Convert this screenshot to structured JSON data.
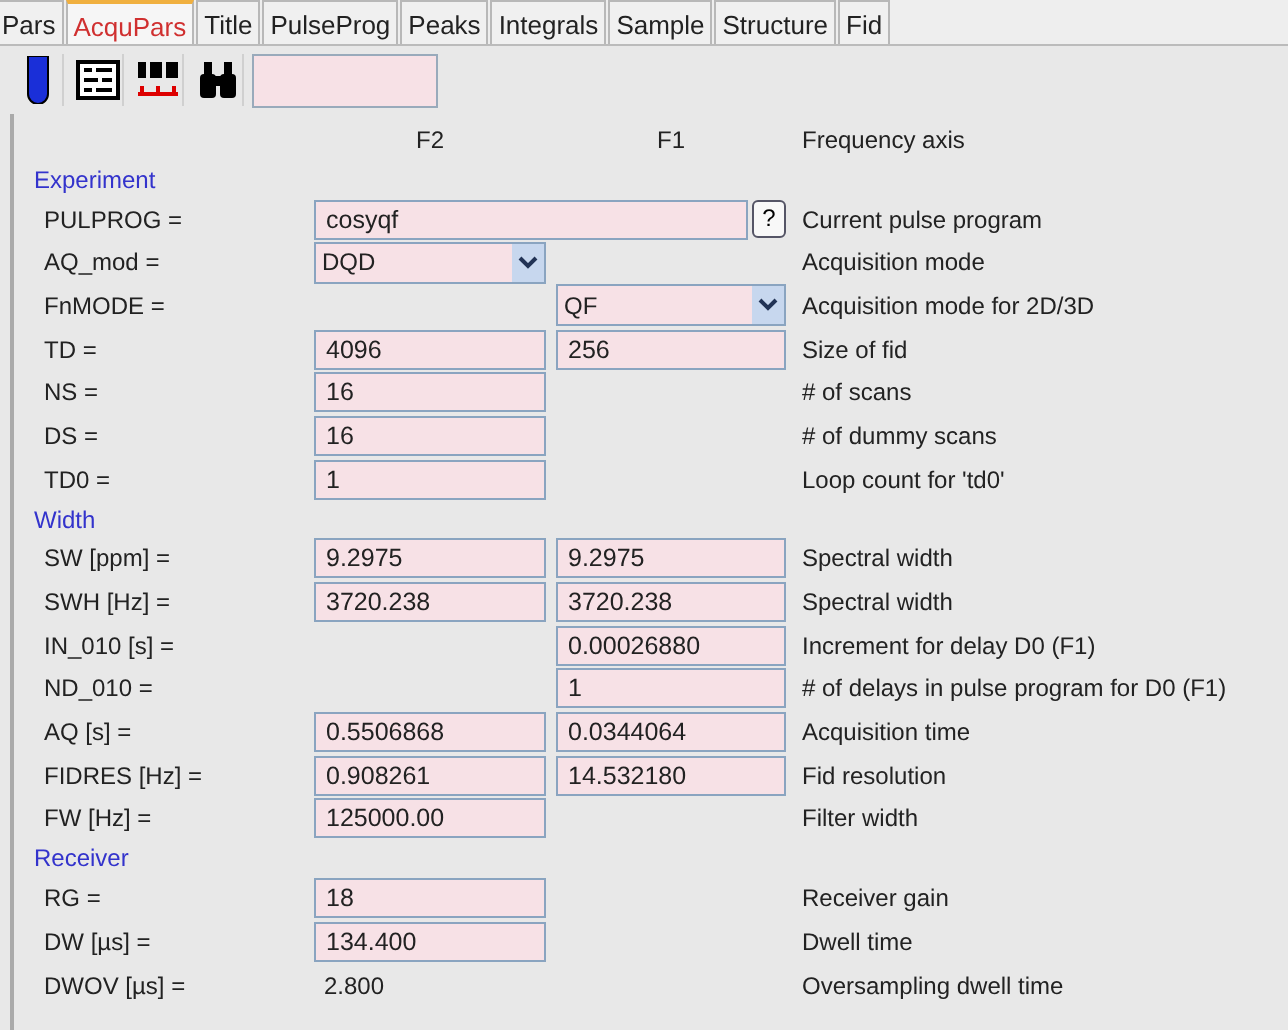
{
  "tabs": [
    {
      "label": "Pars",
      "selected": false
    },
    {
      "label": "AcquPars",
      "selected": true
    },
    {
      "label": "Title",
      "selected": false
    },
    {
      "label": "PulseProg",
      "selected": false
    },
    {
      "label": "Peaks",
      "selected": false
    },
    {
      "label": "Integrals",
      "selected": false
    },
    {
      "label": "Sample",
      "selected": false
    },
    {
      "label": "Structure",
      "selected": false
    },
    {
      "label": "Fid",
      "selected": false
    }
  ],
  "header": {
    "f2": "F2",
    "f1": "F1",
    "description": "Frequency axis"
  },
  "sections": [
    {
      "title": "Experiment",
      "rows": [
        {
          "label": "PULPROG =",
          "f2": {
            "kind": "wide",
            "value": "cosyqf",
            "help": "?"
          },
          "description": "Current pulse program"
        },
        {
          "label": "AQ_mod =",
          "f2": {
            "kind": "select",
            "value": "DQD"
          },
          "description": "Acquisition mode"
        },
        {
          "label": "FnMODE =",
          "f1": {
            "kind": "select",
            "value": "QF"
          },
          "description": "Acquisition mode for 2D/3D"
        },
        {
          "label": "TD =",
          "f2": {
            "kind": "field",
            "value": "4096"
          },
          "f1": {
            "kind": "field",
            "value": "256"
          },
          "description": "Size of fid"
        },
        {
          "label": "NS =",
          "f2": {
            "kind": "field",
            "value": "16"
          },
          "description": "# of scans"
        },
        {
          "label": "DS =",
          "f2": {
            "kind": "field",
            "value": "16"
          },
          "description": "# of dummy scans"
        },
        {
          "label": "TD0 =",
          "f2": {
            "kind": "field",
            "value": "1"
          },
          "description": "Loop count for 'td0'"
        }
      ]
    },
    {
      "title": "Width",
      "rows": [
        {
          "label": "SW [ppm] =",
          "f2": {
            "kind": "field",
            "value": "9.2975"
          },
          "f1": {
            "kind": "field",
            "value": "9.2975"
          },
          "description": "Spectral width"
        },
        {
          "label": "SWH [Hz] =",
          "f2": {
            "kind": "field",
            "value": "3720.238"
          },
          "f1": {
            "kind": "field",
            "value": "3720.238"
          },
          "description": "Spectral width"
        },
        {
          "label": "IN_010 [s] =",
          "f1": {
            "kind": "field",
            "value": "0.00026880"
          },
          "description": "Increment for delay D0 (F1)"
        },
        {
          "label": "ND_010 =",
          "f1": {
            "kind": "field",
            "value": "1"
          },
          "description": "# of delays in pulse program for D0 (F1)"
        },
        {
          "label": "AQ [s] =",
          "f2": {
            "kind": "field",
            "value": "0.5506868"
          },
          "f1": {
            "kind": "field",
            "value": "0.0344064"
          },
          "description": "Acquisition time"
        },
        {
          "label": "FIDRES [Hz] =",
          "f2": {
            "kind": "field",
            "value": "0.908261"
          },
          "f1": {
            "kind": "field",
            "value": "14.532180"
          },
          "description": "Fid resolution"
        },
        {
          "label": "FW [Hz] =",
          "f2": {
            "kind": "field",
            "value": "125000.00"
          },
          "description": "Filter width"
        }
      ]
    },
    {
      "title": "Receiver",
      "rows": [
        {
          "label": "RG =",
          "f2": {
            "kind": "field",
            "value": "18"
          },
          "description": "Receiver gain"
        },
        {
          "label": "DW [µs] =",
          "f2": {
            "kind": "field",
            "value": "134.400"
          },
          "description": "Dwell time"
        },
        {
          "label": "DWOV [µs] =",
          "f2": {
            "kind": "text",
            "value": "2.800"
          },
          "description": "Oversampling dwell time"
        }
      ]
    }
  ]
}
